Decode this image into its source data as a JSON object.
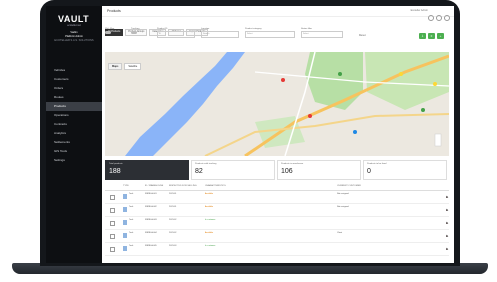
{
  "app": {
    "logo": "VAULT",
    "logo_sub": "ecoteller.net",
    "user": {
      "name": "Vadim",
      "role": "Platform Admin",
      "sub": "ECOTELLER S.A.S. SOLUTIONS"
    }
  },
  "sidebar": {
    "items": [
      {
        "label": "Vehicles"
      },
      {
        "label": "Customers"
      },
      {
        "label": "Orders"
      },
      {
        "label": "Routes"
      },
      {
        "label": "Products",
        "active": true
      },
      {
        "label": "Operations"
      },
      {
        "label": "Contracts"
      },
      {
        "label": "Analytics"
      },
      {
        "label": "Settlements"
      },
      {
        "label": "GIS Tools"
      },
      {
        "label": "Settings"
      }
    ]
  },
  "header": {
    "title": "Products",
    "right_text": "Ecoteller Admin"
  },
  "tabs": [
    {
      "label": "All Products",
      "active": true
    },
    {
      "label": "Product Groups"
    },
    {
      "label": "Categories"
    },
    {
      "label": "Attributes"
    },
    {
      "label": "Import Products"
    }
  ],
  "filters": [
    {
      "label": "With Map",
      "type": "toggle"
    },
    {
      "label": "Tracking",
      "type": "toggle"
    },
    {
      "label": "Product ID",
      "placeholder": "ID"
    },
    {
      "label": "Location",
      "placeholder": "Search"
    },
    {
      "label": "Product category",
      "placeholder": "Select"
    },
    {
      "label": "Status filter",
      "placeholder": "Select"
    }
  ],
  "reset_label": "Reset",
  "map_tabs": [
    {
      "label": "Maps",
      "active": true
    },
    {
      "label": "Satellite"
    }
  ],
  "stats": [
    {
      "label": "Total products",
      "value": "188"
    },
    {
      "label": "Products with tracking",
      "value": "82"
    },
    {
      "label": "Products in warehouse",
      "value": "106"
    },
    {
      "label": "Products to be fixed",
      "value": "0"
    }
  ],
  "table": {
    "headers": [
      "TYPE",
      "ID / WAREHOUSE",
      "INSPECTED FOR SELLING",
      "CHARACTERISTICS",
      "CURRENT CUSTOMER"
    ],
    "rows": [
      {
        "type": "Tank",
        "id": "FIBRE A-001",
        "inspected": "2023-01",
        "status": "Available",
        "status_color": "orange",
        "customer": "Not assigned"
      },
      {
        "type": "Tank",
        "id": "FIBRE A-002",
        "inspected": "2023-01",
        "status": "Available",
        "status_color": "orange",
        "customer": "Not assigned"
      },
      {
        "type": "Tank",
        "id": "FIBRE A-003",
        "inspected": "2023-02",
        "status": "In customer",
        "status_color": "green",
        "customer": ""
      },
      {
        "type": "Tank",
        "id": "FIBRE A-004",
        "inspected": "2023-02",
        "status": "Available",
        "status_color": "orange",
        "customer": "Client"
      },
      {
        "type": "Tank",
        "id": "FIBRE A-005",
        "inspected": "2023-03",
        "status": "In customer",
        "status_color": "green",
        "customer": ""
      }
    ]
  }
}
